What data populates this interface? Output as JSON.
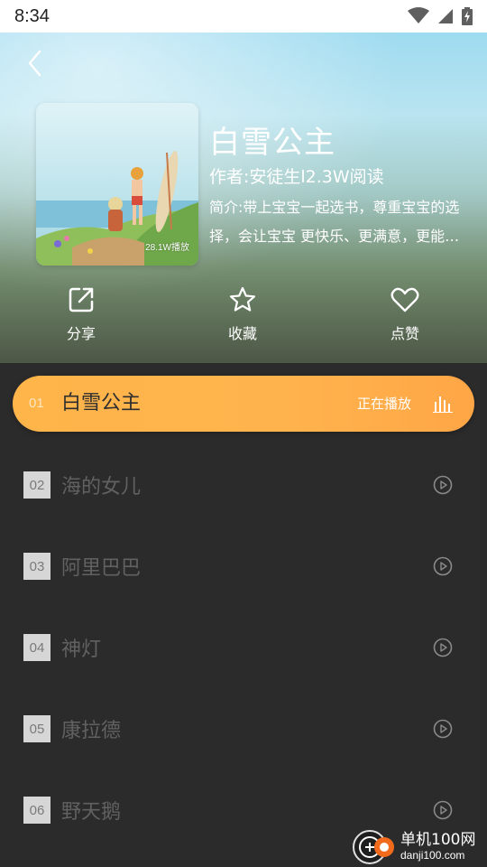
{
  "status_bar": {
    "time": "8:34",
    "icons": [
      "wifi-icon",
      "signal-icon",
      "battery-charging-icon"
    ]
  },
  "header": {
    "back_icon": "chevron-left-icon"
  },
  "book": {
    "title": "白雪公主",
    "author": "作者:安徒生l2.3W阅读",
    "description": "简介:带上宝宝一起选书，尊重宝宝的选择，会让宝宝 更快乐、更满意，更能…",
    "cover_plays": "28.1W播放"
  },
  "actions": [
    {
      "label": "分享",
      "icon": "share-icon"
    },
    {
      "label": "收藏",
      "icon": "star-icon"
    },
    {
      "label": "点赞",
      "icon": "heart-icon"
    }
  ],
  "playlist": {
    "active": {
      "number": "01",
      "title": "白雪公主",
      "status": "正在播放",
      "icon": "equalizer-icon"
    },
    "items": [
      {
        "number": "02",
        "title": "海的女儿",
        "icon": "play-circle-icon"
      },
      {
        "number": "03",
        "title": "阿里巴巴",
        "icon": "play-circle-icon"
      },
      {
        "number": "04",
        "title": "神灯",
        "icon": "play-circle-icon"
      },
      {
        "number": "05",
        "title": "康拉德",
        "icon": "play-circle-icon"
      },
      {
        "number": "06",
        "title": "野天鹅",
        "icon": "play-circle-icon"
      }
    ]
  },
  "watermark": {
    "name": "单机100网",
    "url": "danji100.com"
  },
  "colors": {
    "accent": "#ffb34d",
    "list_bg": "#2b2b2b",
    "number_badge": "#d6d6d6",
    "item_text": "#616161"
  }
}
